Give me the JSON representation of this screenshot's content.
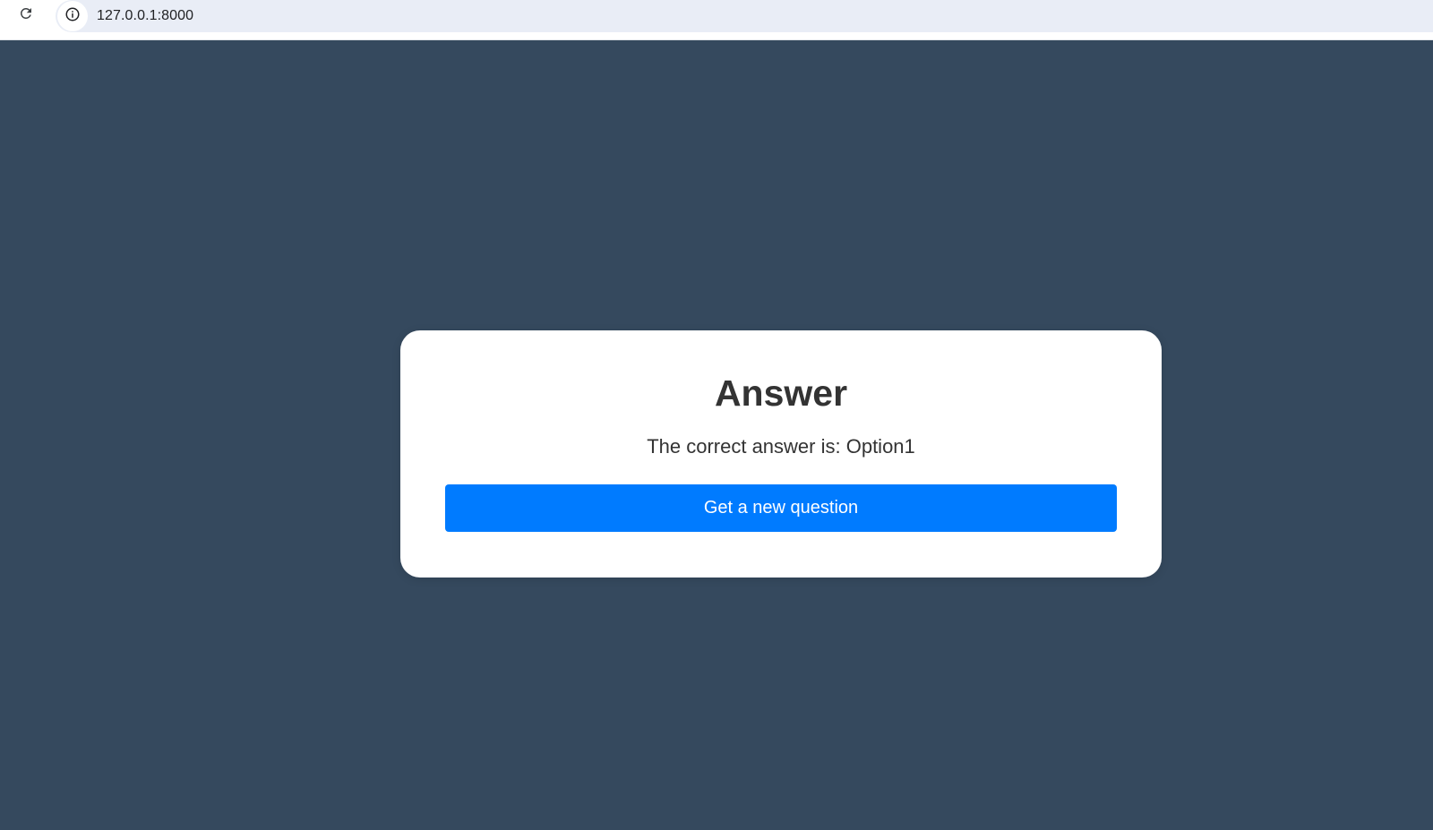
{
  "browser": {
    "url": "127.0.0.1:8000",
    "reload_icon": "reload-icon",
    "site_info_icon": "info-icon"
  },
  "page": {
    "background_color": "#35495e"
  },
  "card": {
    "title": "Answer",
    "answer_text": "The correct answer is: Option1",
    "button_label": "Get a new question",
    "button_color": "#007bff"
  }
}
